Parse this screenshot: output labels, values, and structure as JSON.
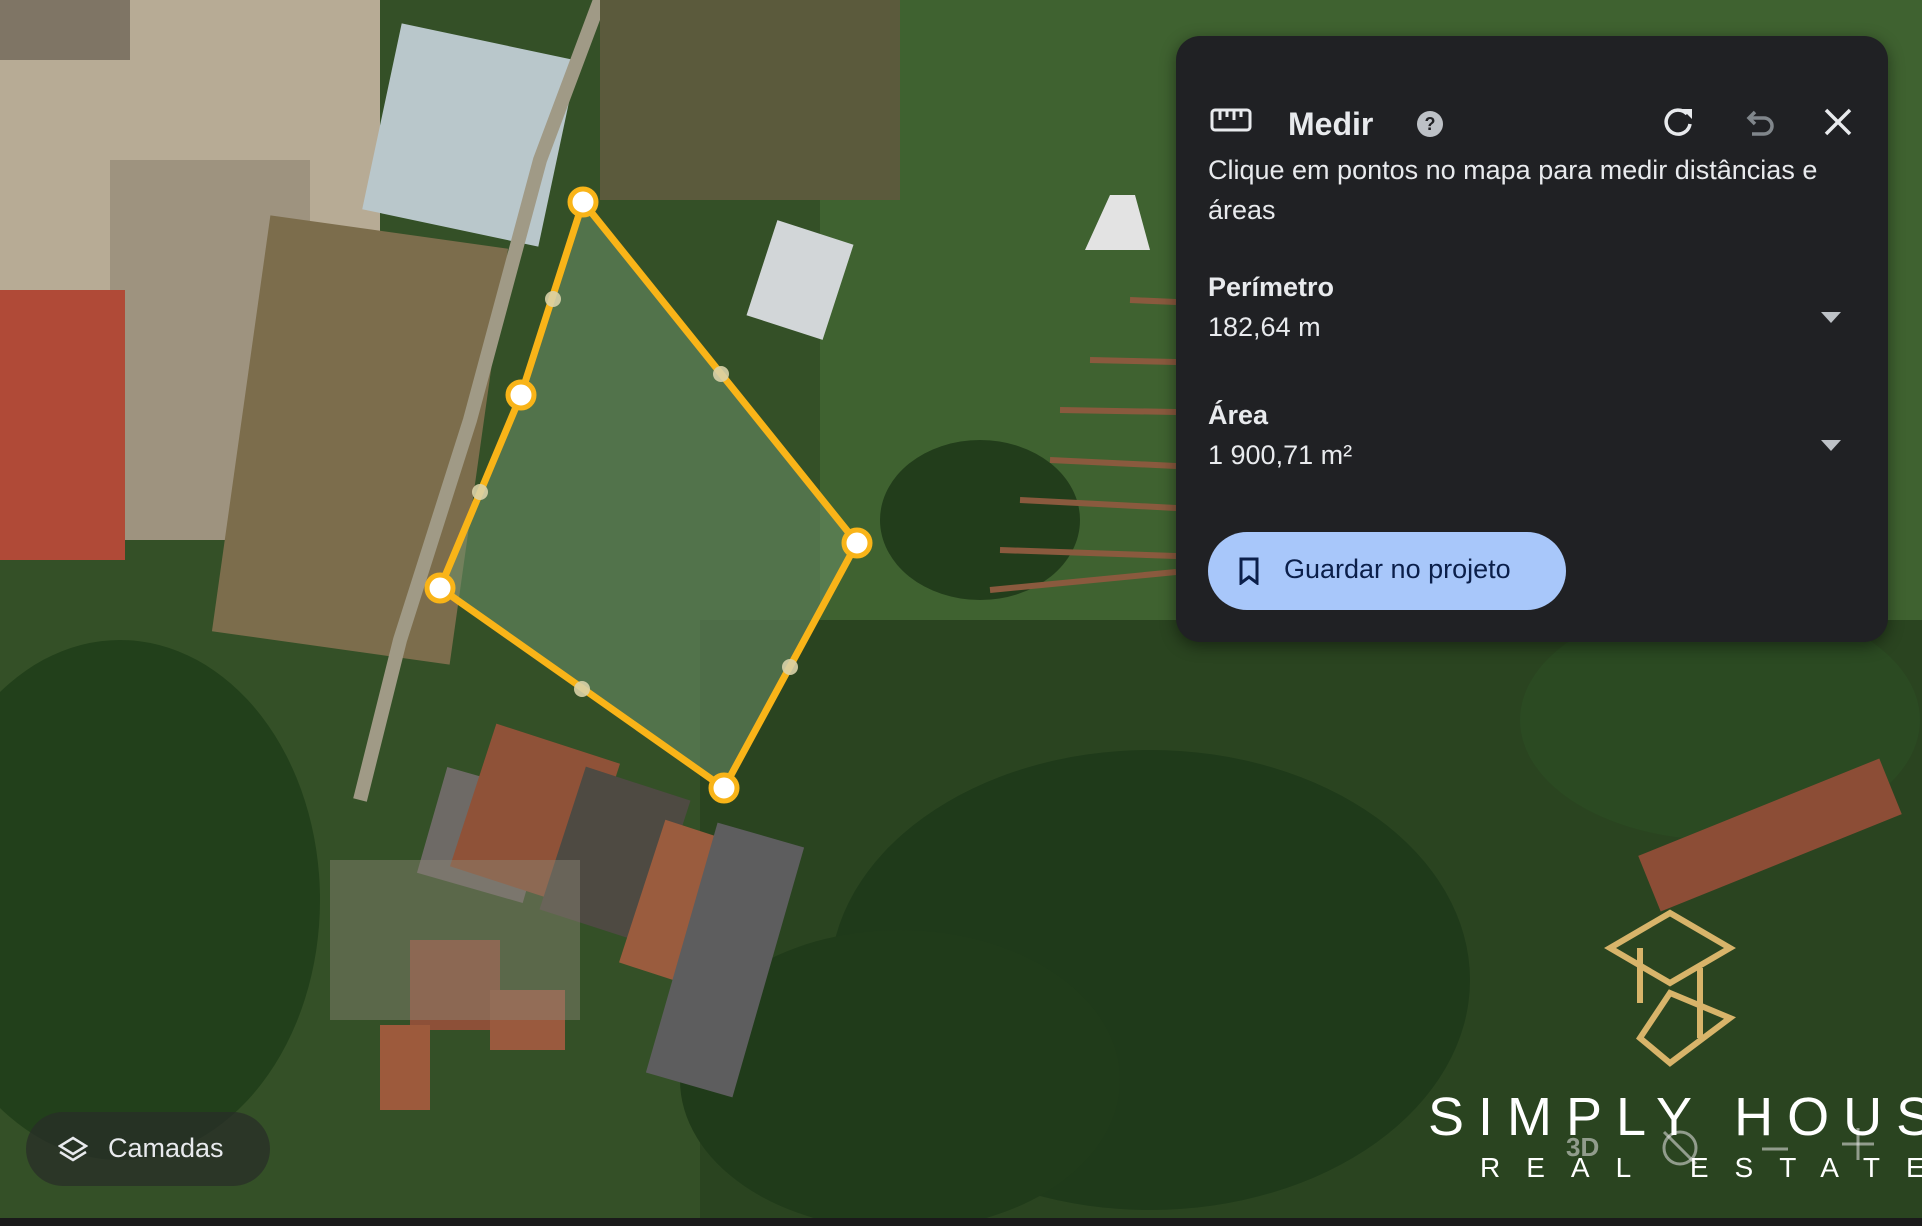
{
  "measure_panel": {
    "title": "Medir",
    "instructions": "Clique em pontos no mapa para medir distâncias e áreas",
    "perimeter": {
      "label": "Perímetro",
      "value": "182,64 m"
    },
    "area": {
      "label": "Área",
      "value": "1 900,71 m²"
    },
    "save_label": "Guardar no projeto",
    "icons": [
      "ruler-icon",
      "help-icon",
      "redo-icon",
      "undo-icon",
      "close-icon",
      "chevron-down-icon",
      "bookmark-icon"
    ]
  },
  "layers_button": {
    "label": "Camadas",
    "icon": "layers-icon"
  },
  "map_controls": {
    "view_3d_label": "3D",
    "icons": [
      "compass-off-icon",
      "zoom-out-icon",
      "zoom-in-icon"
    ]
  },
  "logo": {
    "line1": "SIMPLY HOUSE",
    "line2": "REAL ESTATE"
  },
  "colors": {
    "panel_bg": "#202124",
    "accent_button": "#a8c7fa",
    "polygon_stroke": "#f9b418",
    "vertex_fill": "#ffffff"
  }
}
